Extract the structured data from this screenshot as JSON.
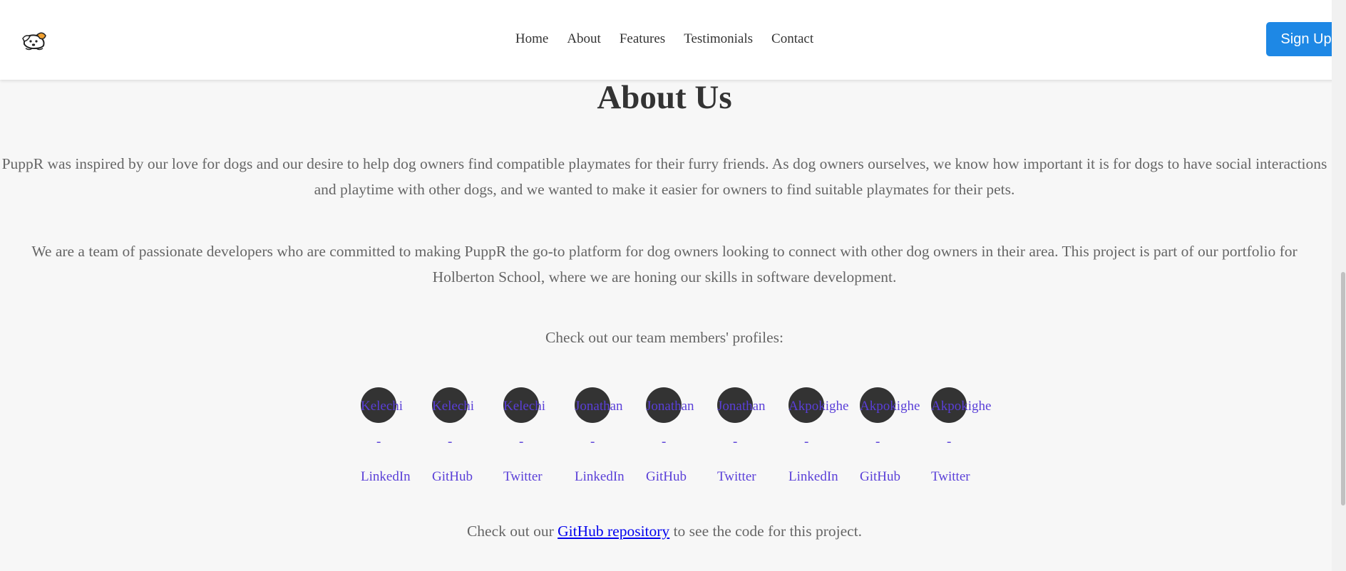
{
  "nav": {
    "links": [
      "Home",
      "About",
      "Features",
      "Testimonials",
      "Contact"
    ],
    "signup_label": "Sign Up"
  },
  "about": {
    "title": "About Us",
    "paragraph_1": "PuppR was inspired by our love for dogs and our desire to help dog owners find compatible playmates for their furry friends. As dog owners ourselves, we know how important it is for dogs to have social interactions and playtime with other dogs, and we wanted to make it easier for owners to find suitable playmates for their pets.",
    "paragraph_2": "We are a team of passionate developers who are committed to making PuppR the go-to platform for dog owners looking to connect with other dog owners in their area. This project is part of our portfolio for Holberton School, where we are honing our skills in software development.",
    "team_heading": "Check out our team members' profiles:",
    "members": [
      {
        "name": "Kelechi",
        "separator": "-",
        "platform": "LinkedIn"
      },
      {
        "name": "Kelechi",
        "separator": "-",
        "platform": "GitHub"
      },
      {
        "name": "Kelechi",
        "separator": "-",
        "platform": "Twitter"
      },
      {
        "name": "Jonathan",
        "separator": "-",
        "platform": "LinkedIn"
      },
      {
        "name": "Jonathan",
        "separator": "-",
        "platform": "GitHub"
      },
      {
        "name": "Jonathan",
        "separator": "-",
        "platform": "Twitter"
      },
      {
        "name": "Akpokighe",
        "separator": "-",
        "platform": "LinkedIn"
      },
      {
        "name": "Akpokighe",
        "separator": "-",
        "platform": "GitHub"
      },
      {
        "name": "Akpokighe",
        "separator": "-",
        "platform": "Twitter"
      }
    ],
    "repo_prefix": "Check out our ",
    "repo_link": "GitHub repository",
    "repo_suffix": " to see the code for this project."
  },
  "colors": {
    "accent": "#1e88e5",
    "link": "#5a3fd8",
    "avatar": "#333333",
    "background": "#f7f7f7"
  }
}
